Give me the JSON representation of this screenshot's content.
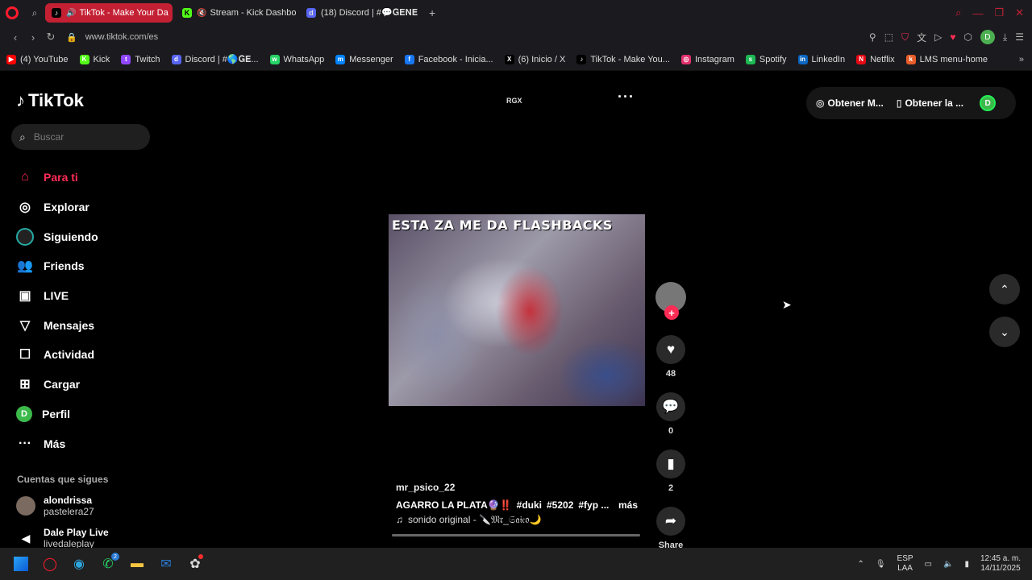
{
  "browser": {
    "tabs": [
      {
        "label": "TikTok - Make Your Da",
        "active": true
      },
      {
        "label": "Stream - Kick Dashbo"
      },
      {
        "label": "(18) Discord | #💬𝐆𝐄𝐍𝐄"
      }
    ],
    "url": "www.tiktok.com/es",
    "bookmarks": [
      {
        "label": "(4) YouTube",
        "color": "#ff0000",
        "glyph": "▶"
      },
      {
        "label": "Kick",
        "color": "#53fc18",
        "glyph": "K"
      },
      {
        "label": "Twitch",
        "color": "#9146ff",
        "glyph": "t"
      },
      {
        "label": "Discord | #🌎𝐆𝐄...",
        "color": "#5865f2",
        "glyph": "d"
      },
      {
        "label": "WhatsApp",
        "color": "#25d366",
        "glyph": "w"
      },
      {
        "label": "Messenger",
        "color": "#0084ff",
        "glyph": "m"
      },
      {
        "label": "Facebook - Inicia...",
        "color": "#1877f2",
        "glyph": "f"
      },
      {
        "label": "(6) Inicio / X",
        "color": "#000000",
        "glyph": "X"
      },
      {
        "label": "TikTok - Make You...",
        "color": "#000000",
        "glyph": "♪"
      },
      {
        "label": "Instagram",
        "color": "#e1306c",
        "glyph": "◎"
      },
      {
        "label": "Spotify",
        "color": "#1db954",
        "glyph": "s"
      },
      {
        "label": "LinkedIn",
        "color": "#0a66c2",
        "glyph": "in"
      },
      {
        "label": "Netflix",
        "color": "#e50914",
        "glyph": "N"
      },
      {
        "label": "LMS menu-home",
        "color": "#e85d2a",
        "glyph": "k"
      }
    ],
    "profile_initial": "D"
  },
  "tiktok": {
    "logo": "TikTok",
    "search_placeholder": "Buscar",
    "nav": [
      {
        "label": "Para ti",
        "icon": "home-icon"
      },
      {
        "label": "Explorar",
        "icon": "compass-icon"
      },
      {
        "label": "Siguiendo",
        "icon": "following-icon"
      },
      {
        "label": "Friends",
        "icon": "friends-icon"
      },
      {
        "label": "LIVE",
        "icon": "live-icon"
      },
      {
        "label": "Mensajes",
        "icon": "send-icon"
      },
      {
        "label": "Actividad",
        "icon": "activity-icon"
      },
      {
        "label": "Cargar",
        "icon": "upload-icon"
      },
      {
        "label": "Perfil",
        "icon": "profile-icon"
      },
      {
        "label": "Más",
        "icon": "more-icon"
      }
    ],
    "profile_initial": "D",
    "following_title": "Cuentas que sigues",
    "following": [
      {
        "name": "alondrissa",
        "handle": "pastelera27"
      },
      {
        "name": "Dale Play Live",
        "handle": "livedaleplay"
      }
    ],
    "rgx": "RGX",
    "get_buttons": [
      "Obtener M...",
      "Obtener la ..."
    ],
    "video": {
      "caption": "ESTA ZA ME DA FLASHBACKS",
      "author": "mr_psico_22",
      "description": "AGARRO LA PLATA🔮‼️",
      "hashtags": [
        "#duki",
        "#5202",
        "#fyp ..."
      ],
      "more": "más",
      "sound": "sonido original - 🔪𝔐𝔯_𝔖𝔞𝔦𝔠𝔬🌙",
      "likes": "48",
      "comments": "0",
      "saves": "2",
      "share": "Share"
    }
  },
  "taskbar": {
    "lang_top": "ESP",
    "lang_bottom": "LAA",
    "time": "12:45 a. m.",
    "date": "14/11/2025",
    "whatsapp_badge": "2"
  }
}
